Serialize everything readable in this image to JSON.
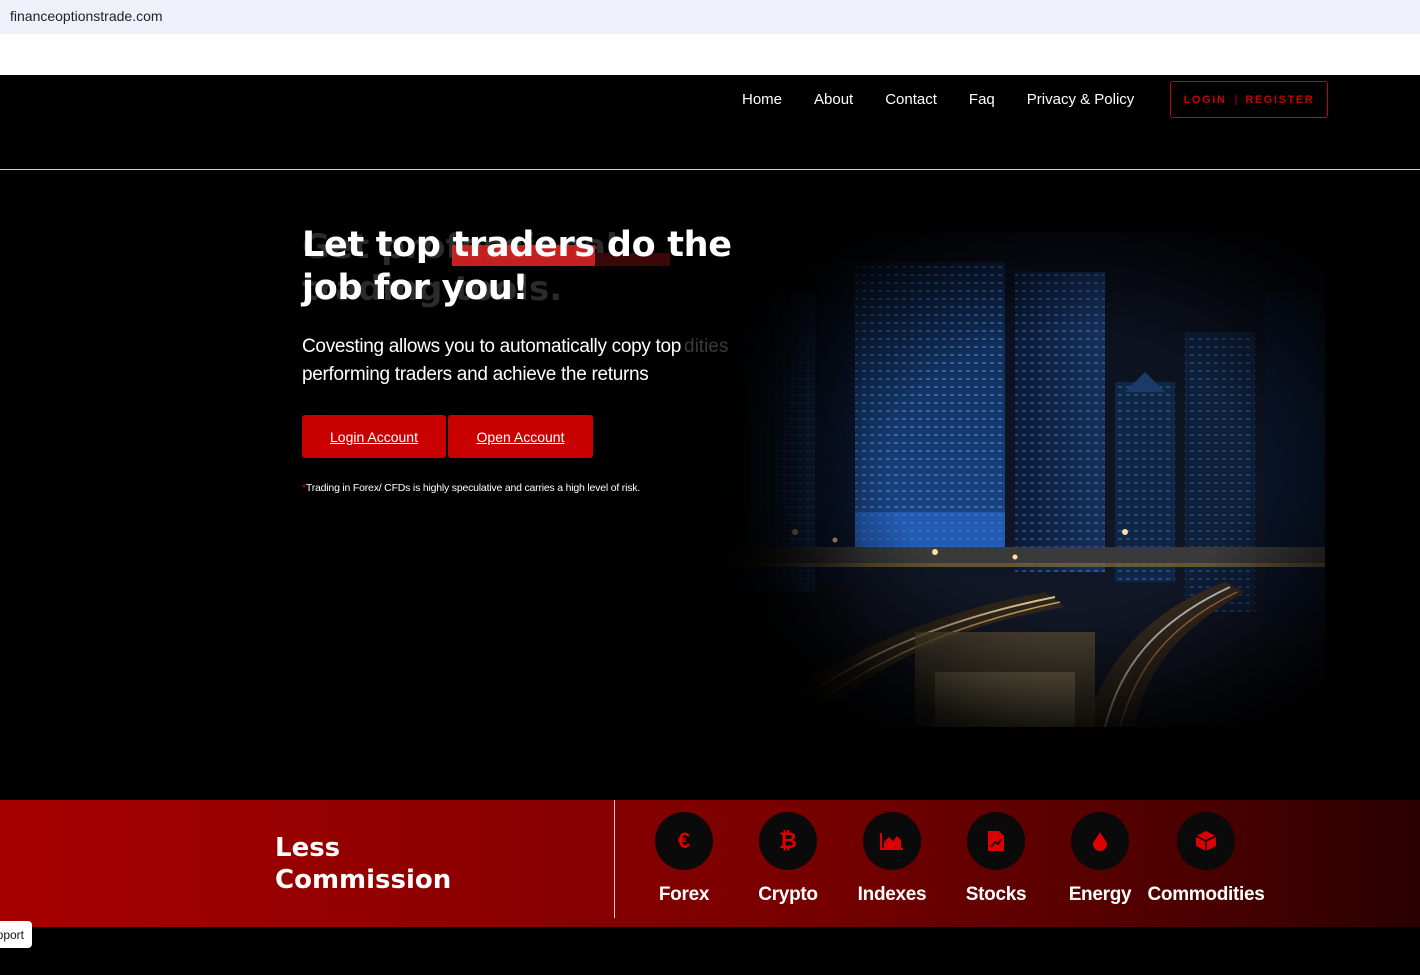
{
  "browser": {
    "url": "financeoptionstrade.com"
  },
  "nav": {
    "items": [
      "Home",
      "About",
      "Contact",
      "Faq",
      "Privacy & Policy"
    ],
    "login": "LOGIN",
    "separator": "|",
    "register": "REGISTER"
  },
  "hero": {
    "title": "Let top traders do the job for you!",
    "ghost_title": "Get professional trading tools.",
    "subtitle": "Covesting allows you to automatically copy top performing traders and achieve the returns",
    "ghost_subtitle": "dities",
    "login_button": "Login Account",
    "open_button": "Open Account",
    "risk_star": "*",
    "risk_text": "Trading in Forex/ CFDs is highly speculative and carries a high level of risk."
  },
  "commission": {
    "title": "Less Commission",
    "markets": [
      {
        "label": "Forex",
        "icon": "euro-icon"
      },
      {
        "label": "Crypto",
        "icon": "bitcoin-icon"
      },
      {
        "label": "Indexes",
        "icon": "area-chart-icon"
      },
      {
        "label": "Stocks",
        "icon": "document-chart-icon"
      },
      {
        "label": "Energy",
        "icon": "drop-icon"
      },
      {
        "label": "Commodities",
        "icon": "box-icon"
      }
    ]
  },
  "support": {
    "label": "Support"
  },
  "colors": {
    "accent": "#c80000",
    "band_start": "#a60000",
    "band_end": "#2a0000"
  }
}
